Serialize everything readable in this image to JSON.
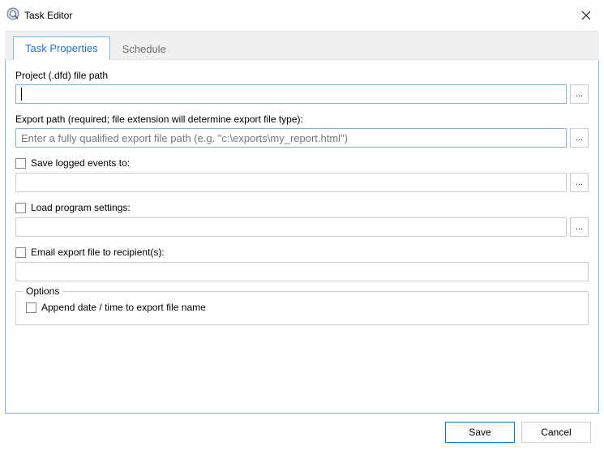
{
  "window": {
    "title": "Task Editor"
  },
  "tabs": {
    "properties": "Task Properties",
    "schedule": "Schedule"
  },
  "labels": {
    "project_path": "Project (.dfd) file path",
    "export_path": "Export path (required; file extension will determine export file type):",
    "save_events": "Save logged events to:",
    "load_settings": "Load program settings:",
    "email_recipients": "Email export file to recipient(s):",
    "options_legend": "Options",
    "append_datetime": "Append date / time to export file name"
  },
  "inputs": {
    "project_path": "",
    "export_path": "",
    "export_path_placeholder": "Enter a fully qualified export file path (e.g. \"c:\\exports\\my_report.html\")",
    "save_events": "",
    "load_settings": "",
    "email_recipients": ""
  },
  "buttons": {
    "browse": "...",
    "save": "Save",
    "cancel": "Cancel"
  }
}
